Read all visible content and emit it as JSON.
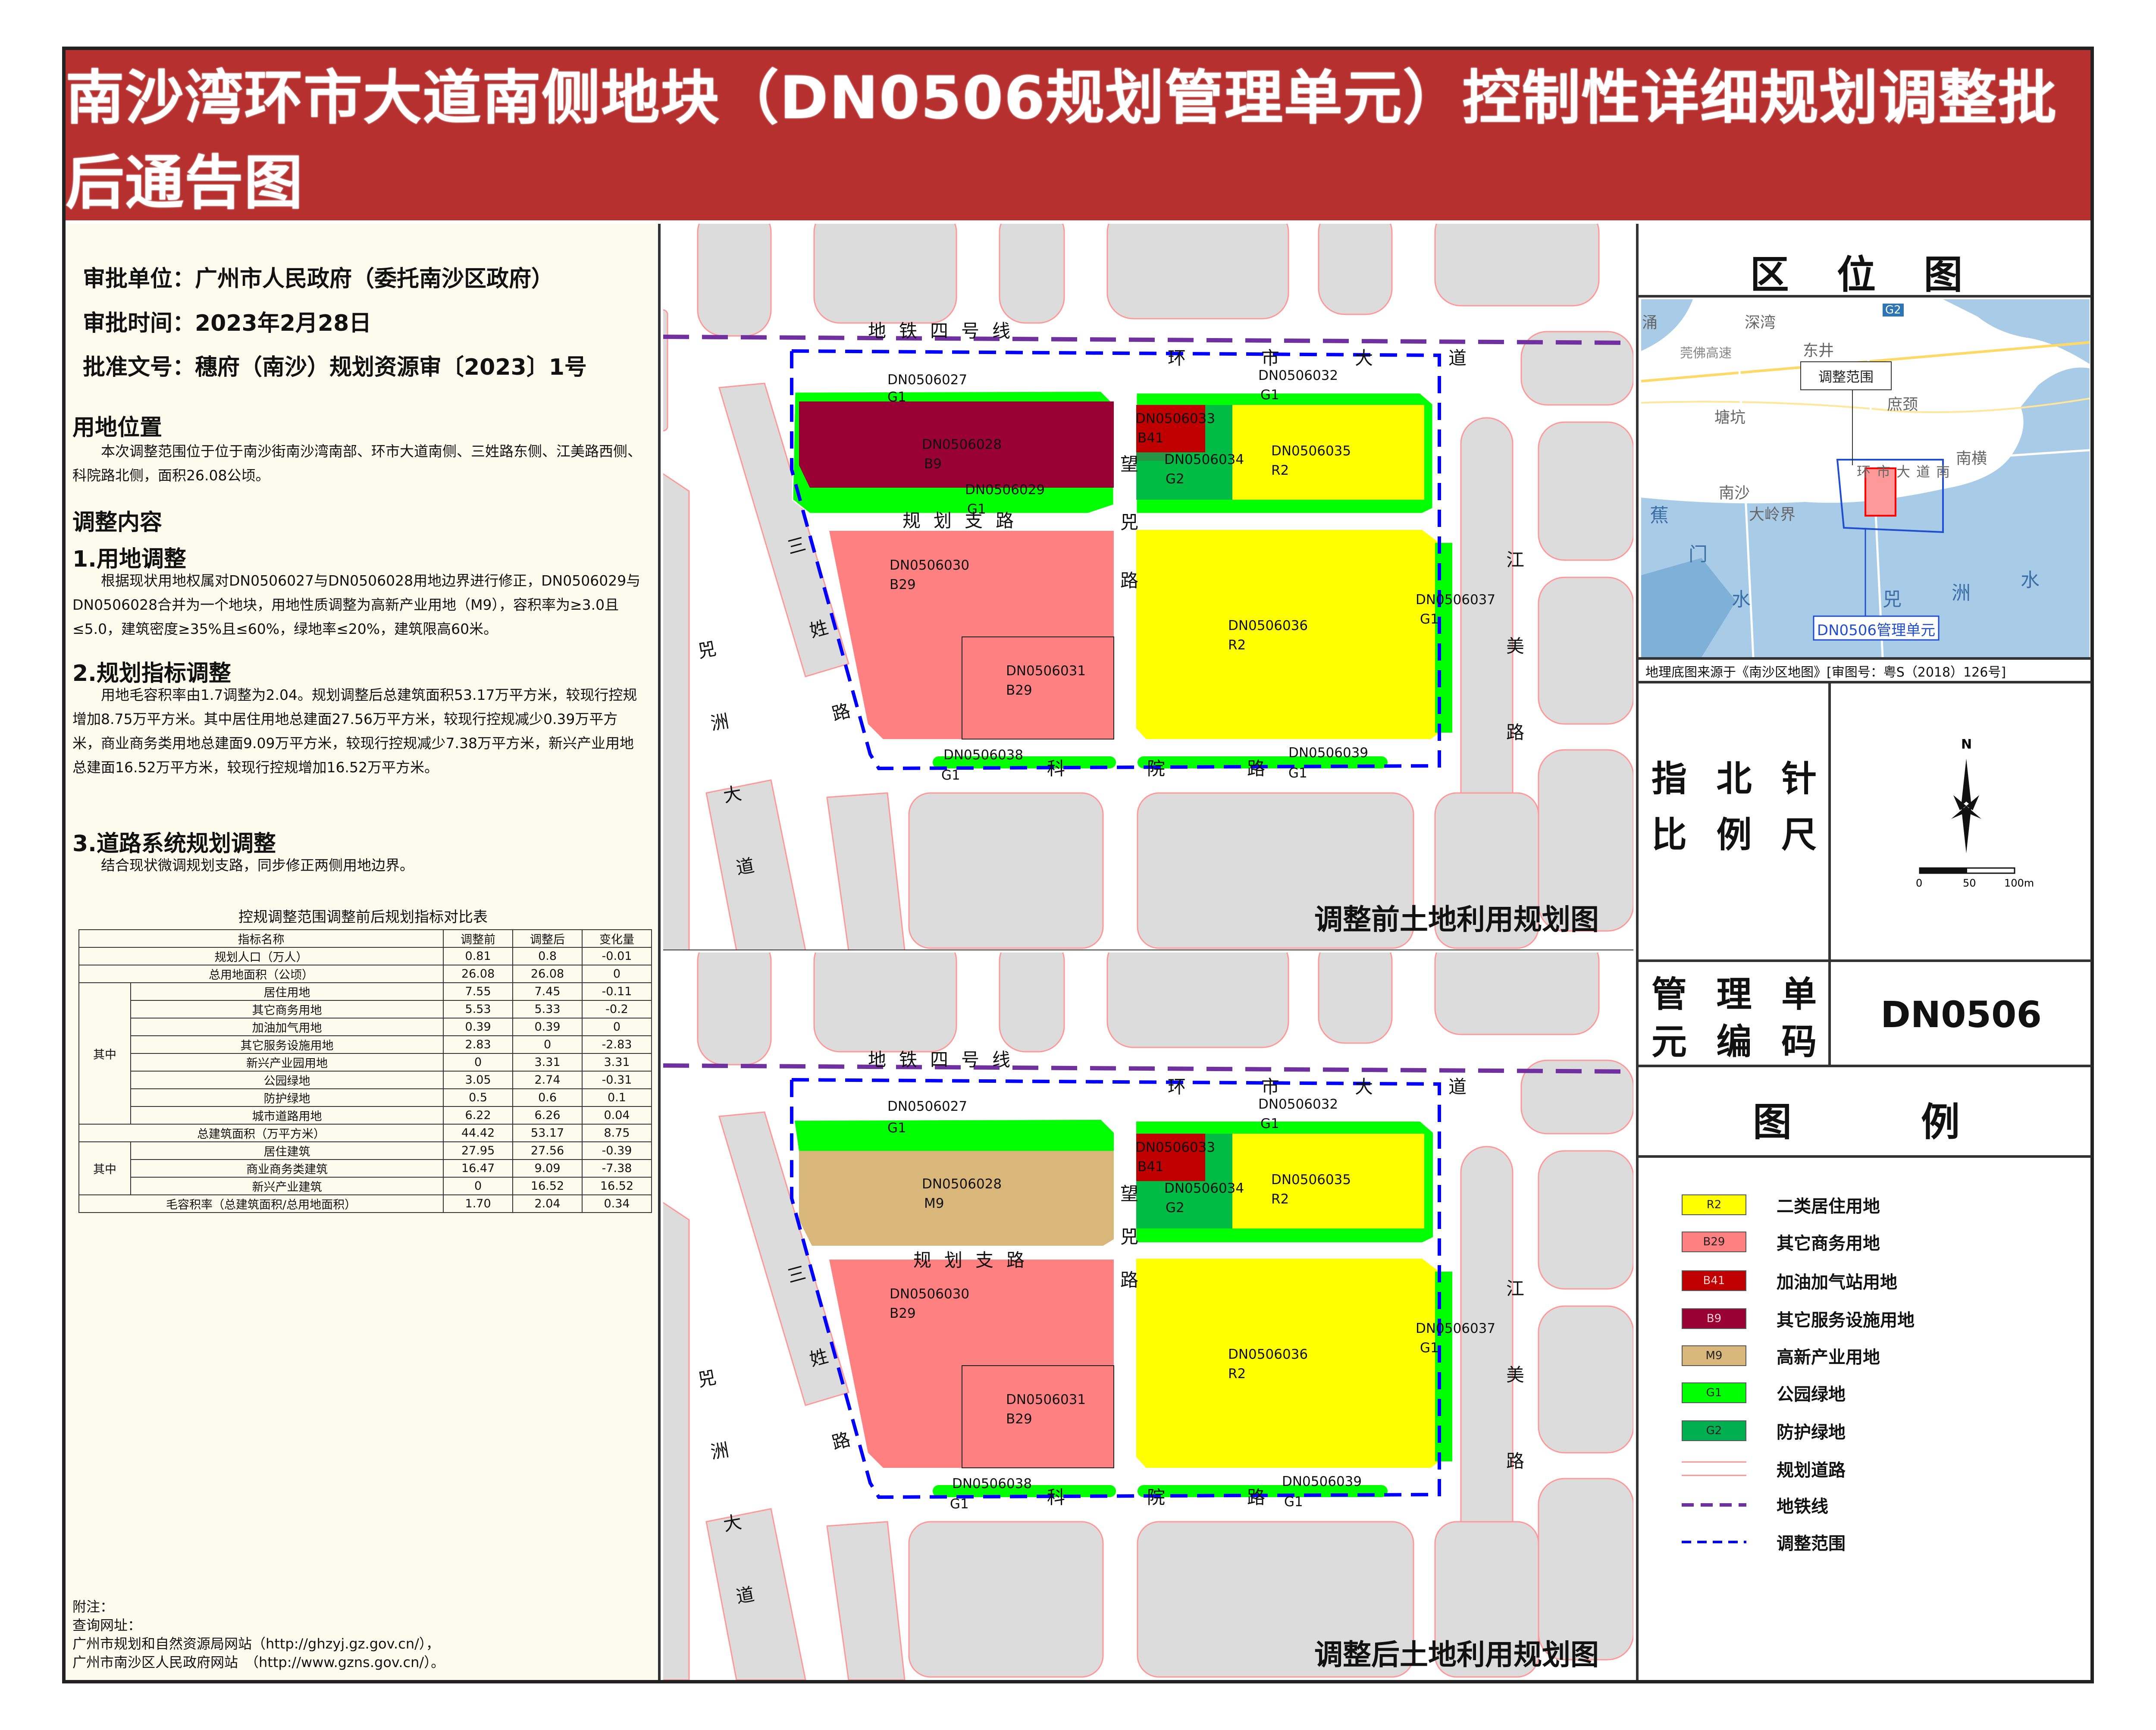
{
  "title": "南沙湾环市大道南侧地块（DN0506规划管理单元）控制性详细规划调整批后通告图",
  "approval": {
    "unit": "审批单位：广州市人民政府（委托南沙区政府）",
    "time": "审批时间：2023年2月28日",
    "doc": "批准文号：穗府（南沙）规划资源审〔2023〕1号"
  },
  "location": {
    "heading": "用地位置",
    "text": "本次调整范围位于位于南沙街南沙湾南部、环市大道南侧、三姓路东侧、江美路西侧、科院路北侧，面积26.08公顷。"
  },
  "adjust": {
    "heading": "调整内容",
    "s1_heading": "1.用地调整",
    "s1_text": "根据现状用地权属对DN0506027与DN0506028用地边界进行修正，DN0506029与DN0506028合并为一个地块，用地性质调整为高新产业用地（M9），容积率为≥3.0且≤5.0，建筑密度≥35%且≤60%，绿地率≤20%，建筑限高60米。",
    "s2_heading": "2.规划指标调整",
    "s2_text": "用地毛容积率由1.7调整为2.04。规划调整后总建筑面积53.17万平方米，较现行控规增加8.75万平方米。其中居住用地总建面27.56万平方米，较现行控规减少0.39万平方米，商业商务类用地总建面9.09万平方米，较现行控规减少7.38万平方米，新兴产业用地总建面16.52万平方米，较现行控规增加16.52万平方米。",
    "s3_heading": "3.道路系统规划调整",
    "s3_text": "结合现状微调规划支路，同步修正两侧用地边界。"
  },
  "table": {
    "caption": "控规调整范围调整前后规划指标对比表",
    "headers": [
      "指标名称",
      "调整前",
      "调整后",
      "变化量"
    ],
    "group1": "其中",
    "group2": "其中",
    "rows": [
      {
        "name": "规划人口（万人）",
        "before": "0.81",
        "after": "0.8",
        "delta": "-0.01"
      },
      {
        "name": "总用地面积（公顷）",
        "before": "26.08",
        "after": "26.08",
        "delta": "0"
      },
      {
        "name": "居住用地",
        "before": "7.55",
        "after": "7.45",
        "delta": "-0.11"
      },
      {
        "name": "其它商务用地",
        "before": "5.53",
        "after": "5.33",
        "delta": "-0.2"
      },
      {
        "name": "加油加气用地",
        "before": "0.39",
        "after": "0.39",
        "delta": "0"
      },
      {
        "name": "其它服务设施用地",
        "before": "2.83",
        "after": "0",
        "delta": "-2.83"
      },
      {
        "name": "新兴产业园用地",
        "before": "0",
        "after": "3.31",
        "delta": "3.31"
      },
      {
        "name": "公园绿地",
        "before": "3.05",
        "after": "2.74",
        "delta": "-0.31"
      },
      {
        "name": "防护绿地",
        "before": "0.5",
        "after": "0.6",
        "delta": "0.1"
      },
      {
        "name": "城市道路用地",
        "before": "6.22",
        "after": "6.26",
        "delta": "0.04"
      },
      {
        "name": "总建筑面积（万平方米）",
        "before": "44.42",
        "after": "53.17",
        "delta": "8.75"
      },
      {
        "name": "居住建筑",
        "before": "27.95",
        "after": "27.56",
        "delta": "-0.39"
      },
      {
        "name": "商业商务类建筑",
        "before": "16.47",
        "after": "9.09",
        "delta": "-7.38"
      },
      {
        "name": "新兴产业建筑",
        "before": "0",
        "after": "16.52",
        "delta": "16.52"
      },
      {
        "name": "毛容积率（总建筑面积/总用地面积）",
        "before": "1.70",
        "after": "2.04",
        "delta": "0.34"
      }
    ]
  },
  "notes": {
    "l1": "附注：",
    "l2": "查询网址：",
    "l3": "广州市规划和自然资源局网站（http://ghzyj.gz.gov.cn/），",
    "l4": "广州市南沙区人民政府网站　（http://www.gzns.gov.cn/）。"
  },
  "map_before": {
    "caption": "调整前土地利用规划图",
    "parcels": {
      "p27": "DN0506027",
      "p27c": "G1",
      "p28": "DN0506028",
      "p28c": "B9",
      "p29": "DN0506029",
      "p29c": "G1",
      "p30": "DN0506030",
      "p30c": "B29",
      "p31": "DN0506031",
      "p31c": "B29",
      "p32": "DN0506032",
      "p32c": "G1",
      "p33": "DN0506033",
      "p33c": "B41",
      "p34": "DN0506034",
      "p34c": "G2",
      "p35": "DN0506035",
      "p35c": "R2",
      "p36": "DN0506036",
      "p36c": "R2",
      "p37": "DN0506037",
      "p37c": "G1",
      "p38": "DN0506038",
      "p38c": "G1",
      "p39": "DN0506039",
      "p39c": "G1"
    }
  },
  "map_after": {
    "caption": "调整后土地利用规划图",
    "parcels": {
      "p27": "DN0506027",
      "p27c": "G1",
      "p28": "DN0506028",
      "p28c": "M9",
      "p30": "DN0506030",
      "p30c": "B29",
      "p31": "DN0506031",
      "p31c": "B29",
      "p32": "DN0506032",
      "p32c": "G1",
      "p33": "DN0506033",
      "p33c": "B41",
      "p34": "DN0506034",
      "p34c": "G2",
      "p35": "DN0506035",
      "p35c": "R2",
      "p36": "DN0506036",
      "p36c": "R2",
      "p37": "DN0506037",
      "p37c": "G1",
      "p38": "DN0506038",
      "p38c": "G1",
      "p39": "DN0506039",
      "p39c": "G1"
    }
  },
  "roads": {
    "metro": "地铁四号线",
    "huanshi": "环市大道",
    "wangxian": "望兕路",
    "zhilu": "规划支路",
    "sanxing": "三姓路",
    "jiangmei": "江美路",
    "xizhou": "兕洲大道",
    "keyuan": "科院路"
  },
  "location_map": {
    "title": "区 位 图",
    "places": [
      "涌",
      "深湾",
      "东井",
      "莞佛高速",
      "调整范围",
      "塘坑",
      "蕉",
      "门",
      "水",
      "兕",
      "洲",
      "水",
      "南横",
      "南沙",
      "大岭界",
      "环市大道南",
      "庶颈",
      "G2"
    ],
    "unit_label": "DN0506管理单元",
    "source": "地理底图来源于《南沙区地图》[审图号：粤S（2018）126号]"
  },
  "north": {
    "title_line1": "指 北 针",
    "title_line2": "比 例 尺",
    "n": "N",
    "scale": [
      "0",
      "50",
      "100m"
    ]
  },
  "unit_code": {
    "label_line1": "管 理 单",
    "label_line2": "元 编 码",
    "value": "DN0506"
  },
  "legend": {
    "title": "图　　例",
    "items": [
      {
        "code": "R2",
        "label": "二类居住用地",
        "color": "#ffff00"
      },
      {
        "code": "B29",
        "label": "其它商务用地",
        "color": "#ff8080"
      },
      {
        "code": "B41",
        "label": "加油加气站用地",
        "color": "#c00000"
      },
      {
        "code": "B9",
        "label": "其它服务设施用地",
        "color": "#990033"
      },
      {
        "code": "M9",
        "label": "高新产业用地",
        "color": "#d9b77a"
      },
      {
        "code": "G1",
        "label": "公园绿地",
        "color": "#00ff00"
      },
      {
        "code": "G2",
        "label": "防护绿地",
        "color": "#00b050"
      },
      {
        "code": "",
        "label": "规划道路",
        "color": "#ffffff"
      },
      {
        "code": "",
        "label": "地铁线",
        "color": "#7030a0"
      },
      {
        "code": "",
        "label": "调整范围",
        "color": "#0000ff"
      }
    ]
  },
  "colors": {
    "title_bg": "#b5302e",
    "r2": "#ffff00",
    "b29": "#ff8080",
    "b41": "#c00000",
    "b9": "#990033",
    "m9": "#d9b77a",
    "g1": "#00ff00",
    "g2": "#00b050",
    "metro": "#7030a0",
    "boundary": "#0000ff",
    "road_bg": "#dcdcdc",
    "road_edge": "#ff9999"
  }
}
